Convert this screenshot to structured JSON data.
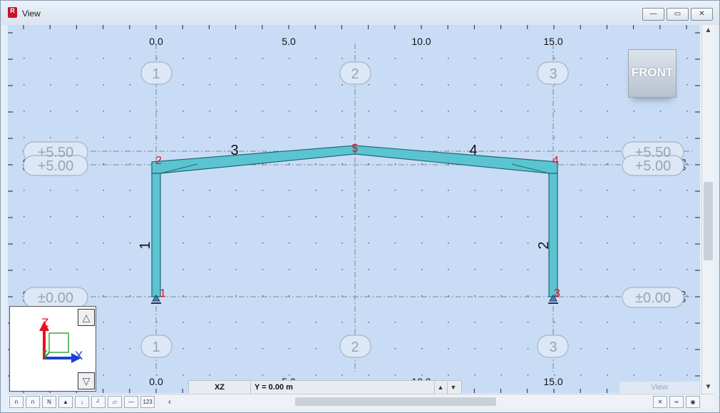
{
  "window": {
    "title": "View",
    "app_icon": "R"
  },
  "controls": {
    "minimize": "—",
    "maximize": "▭",
    "close": "✕"
  },
  "top_ruler": [
    "0.0",
    "5.0",
    "10.0",
    "15.0"
  ],
  "bottom_ruler": [
    "0.0",
    "5.0",
    "10.0",
    "15.0"
  ],
  "grid_lines": {
    "top": [
      "1",
      "2",
      "3"
    ],
    "bottom": [
      "1",
      "2",
      "3"
    ]
  },
  "levels": {
    "l550": "+5.50",
    "l500": "+5.00",
    "l000": "±0.00"
  },
  "side_ruler": {
    "top": "5.0",
    "bottom": "0.0"
  },
  "members": [
    "1",
    "2",
    "3",
    "4"
  ],
  "nodes": [
    "1",
    "2",
    "3",
    "4",
    "5"
  ],
  "view_cube": {
    "label": "FRONT"
  },
  "coord_bar": {
    "plane": "XZ",
    "y_value": "Y = 0.00 m"
  },
  "view_label": "View",
  "axes": {
    "z": "Z",
    "x": "X",
    "y": "Y"
  },
  "colors": {
    "member": "#5bc4d1",
    "member_stroke": "#1d6872",
    "node": "#e8101a",
    "canvas": "#c9dcf6"
  },
  "toolbar_icons": [
    "numbering-icon",
    "node-numbering-icon",
    "member-numbering-icon",
    "support-icon",
    "load-icon",
    "axis-icon",
    "surface-icon",
    "line-icon",
    "values-icon"
  ]
}
